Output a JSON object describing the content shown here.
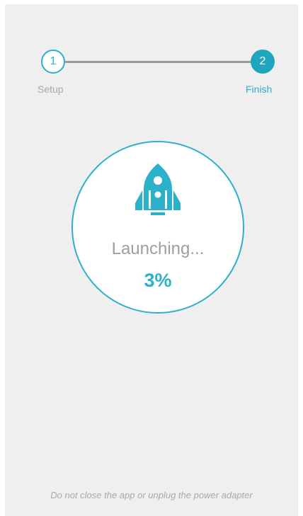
{
  "stepper": {
    "steps": [
      {
        "number": "1",
        "label": "Setup",
        "state": "done"
      },
      {
        "number": "2",
        "label": "Finish",
        "state": "active"
      }
    ]
  },
  "progress": {
    "icon": "rocket-icon",
    "status": "Launching...",
    "percent_text": "3%",
    "percent_value": 3
  },
  "footer": {
    "note": "Do not close the app or unplug the power adapter"
  },
  "colors": {
    "accent": "#2bb1c9",
    "accent_dark": "#1fa5be",
    "background": "#efefef",
    "muted_text": "#a8a8a8"
  }
}
